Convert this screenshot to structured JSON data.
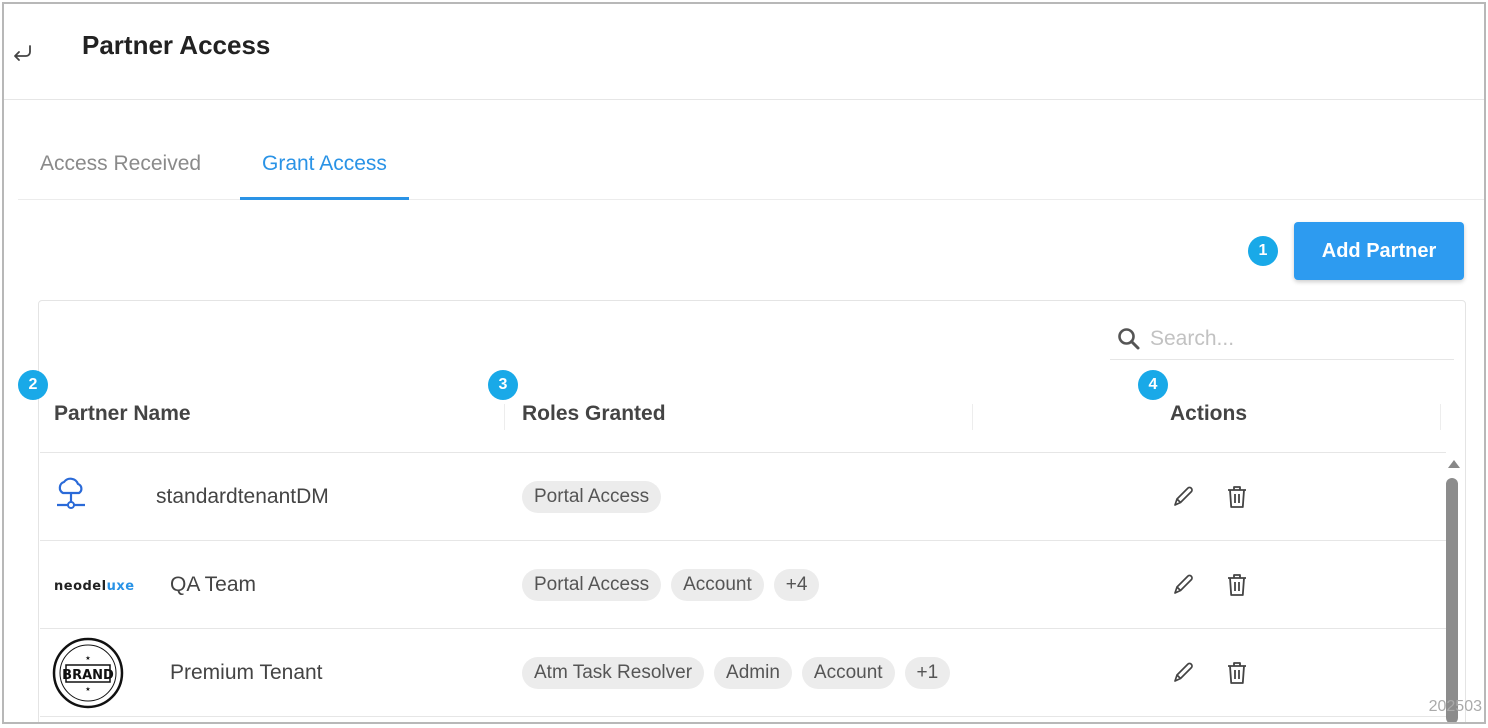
{
  "header": {
    "title": "Partner Access",
    "back_icon": "return-arrow-icon"
  },
  "tabs": [
    {
      "label": "Access Received",
      "active": false
    },
    {
      "label": "Grant Access",
      "active": true
    }
  ],
  "toolbar": {
    "add_partner_label": "Add Partner"
  },
  "badges": {
    "b1": "1",
    "b2": "2",
    "b3": "3",
    "b4": "4"
  },
  "search": {
    "placeholder": "Search..."
  },
  "table": {
    "columns": [
      "Partner Name",
      "Roles Granted",
      "Actions"
    ],
    "rows": [
      {
        "logo": "cloud-network-icon",
        "name": "standardtenantDM",
        "roles": [
          "Portal Access"
        ]
      },
      {
        "logo": "neodeluxe-logo",
        "logo_text_a": "neodel",
        "logo_text_b": "uxe",
        "name": "QA Team",
        "roles": [
          "Portal Access",
          "Account",
          "+4"
        ]
      },
      {
        "logo": "brand-seal-logo",
        "name": "Premium Tenant",
        "roles": [
          "Atm Task Resolver",
          "Admin",
          "Account",
          "+1"
        ]
      }
    ]
  },
  "footer": {
    "id_text": "202503"
  },
  "colors": {
    "accent": "#2d9bf0",
    "badge": "#19a9e8",
    "chip_bg": "#ececec"
  }
}
